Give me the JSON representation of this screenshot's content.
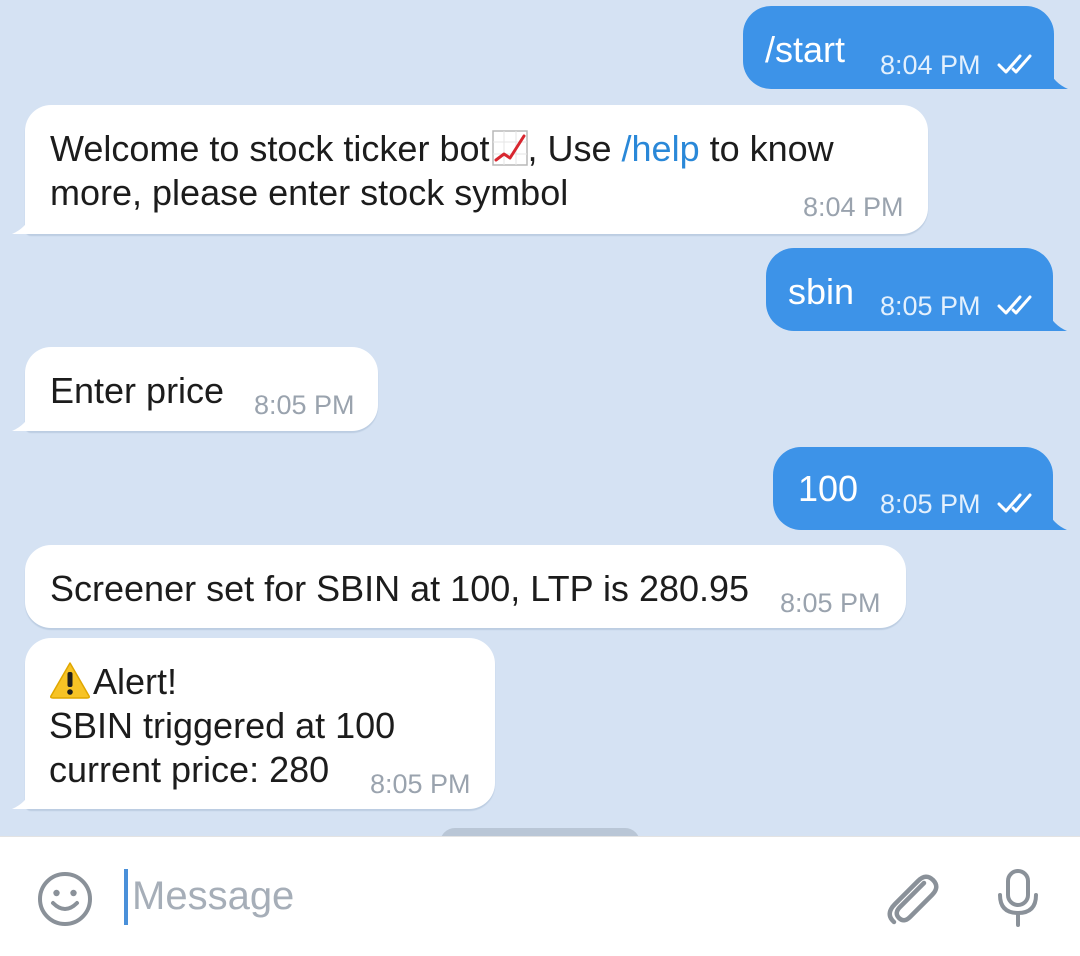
{
  "messages": [
    {
      "direction": "out",
      "text": "/start",
      "time": "8:04 PM",
      "status": "double-check-read"
    },
    {
      "direction": "in",
      "line1_a": "Welcome to stock ticker bot",
      "emoji": "chart-increasing-icon",
      "line1_b": ", Use ",
      "link": "/help",
      "line1_c": " to know",
      "line2": "more, please enter stock symbol",
      "time": "8:04 PM"
    },
    {
      "direction": "out",
      "text": "sbin",
      "time": "8:05 PM",
      "status": "double-check-read"
    },
    {
      "direction": "in",
      "text": "Enter price",
      "time": "8:05 PM"
    },
    {
      "direction": "out",
      "text": "100",
      "time": "8:05 PM",
      "status": "double-check-read"
    },
    {
      "direction": "in",
      "text": "Screener set for SBIN at 100, LTP is 280.95",
      "time": "8:05 PM"
    },
    {
      "direction": "in",
      "emoji": "warning-icon",
      "line1": "Alert!",
      "line2": "SBIN triggered at 100",
      "line3": "current price: 280",
      "time": "8:05 PM"
    }
  ],
  "composer": {
    "placeholder": "Message",
    "left_icon": "emoji-smile-icon",
    "attach_icon": "paperclip-icon",
    "mic_icon": "microphone-icon"
  },
  "colors": {
    "chat_background": "#d5e2f3",
    "outgoing_bubble": "#3d93e8",
    "incoming_bubble": "#ffffff",
    "link": "#2a88d8"
  }
}
